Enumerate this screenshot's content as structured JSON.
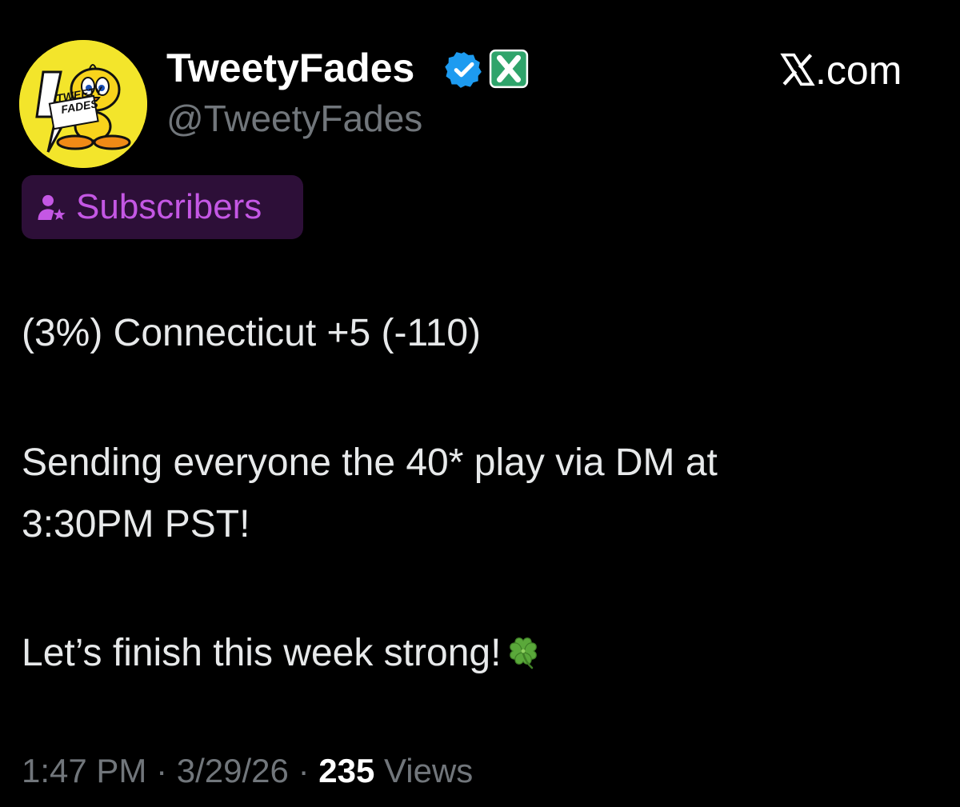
{
  "author": {
    "display_name": "TweetyFades",
    "handle": "@TweetyFades",
    "avatar_text_line1": "TWEETY",
    "avatar_text_line2": "FADES",
    "avatar_bg": "#f3e52b",
    "verified_icon": "verified-badge-icon",
    "verified_color": "#1d9bf0",
    "affiliate_icon": "x-affiliate-badge-icon",
    "affiliate_color": "#2fa46b"
  },
  "site": {
    "label": ".com",
    "logo_icon": "x-logo-icon"
  },
  "audience_badge": {
    "label": "Subscribers",
    "icon": "subscriber-person-star-icon",
    "text_color": "#c457e4",
    "bg_color": "#2d0f38"
  },
  "tweet": {
    "line1": "(3%) Connecticut +5 (-110)",
    "line2": "Sending everyone the 40* play via DM at",
    "line3": "3:30PM PST!",
    "line4": "Let’s finish this week strong!",
    "emoji": "four-leaf-clover-icon"
  },
  "meta": {
    "time": "1:47 PM",
    "separator": "·",
    "date": "3/29/26",
    "views_count": "235",
    "views_label": "Views"
  }
}
